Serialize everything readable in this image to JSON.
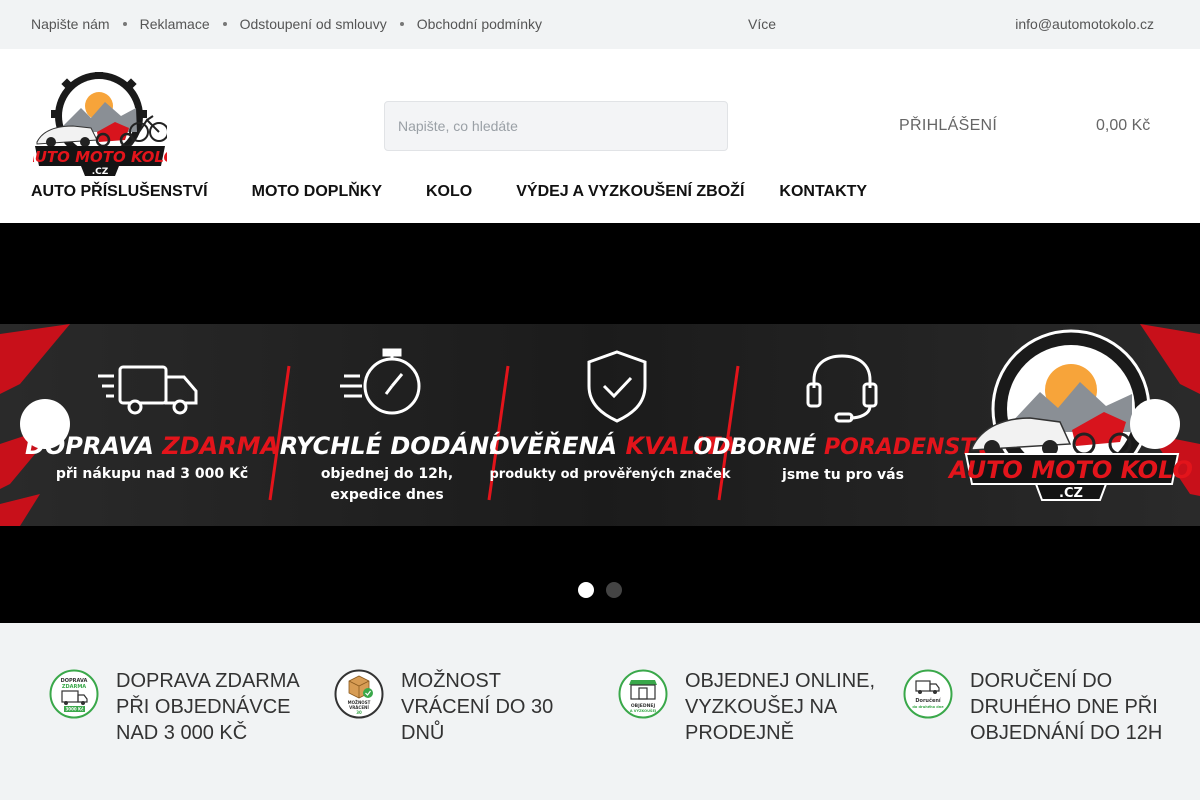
{
  "topbar": {
    "links": [
      "Napište nám",
      "Reklamace",
      "Odstoupení od smlouvy",
      "Obchodní podmínky"
    ],
    "more": "Více",
    "email": "info@automotokolo.cz"
  },
  "header": {
    "logo_text_1": "AUTO MOTO KOLO",
    "logo_text_2": ".CZ",
    "search_placeholder": "Napište, co hledáte",
    "login": "PŘIHLÁŠENÍ",
    "cart_total": "0,00 Kč"
  },
  "nav": [
    "AUTO PŘÍSLUŠENSTVÍ",
    "MOTO DOPLŇKY",
    "KOLO",
    "VÝDEJ A VYZKOUŠENÍ ZBOŽÍ",
    "KONTAKTY"
  ],
  "hero": {
    "items": [
      {
        "title_white": "DOPRAVA",
        "title_red": "ZDARMA",
        "sub": "při nákupu nad 3 000 Kč"
      },
      {
        "title_white": "RYCHLÉ DODÁNÍ",
        "title_red": "",
        "sub1": "objednej do 12h,",
        "sub2": "expedice dnes"
      },
      {
        "title_white": "OVĚŘENÁ",
        "title_red": "KVALITA",
        "sub": "produkty od prověřených značek"
      },
      {
        "title_white": "ODBORNÉ",
        "title_red": "PORADENSTVÍ",
        "sub": "jsme tu pro vás"
      }
    ],
    "slides_active": 0,
    "slide_count": 2
  },
  "benefits": [
    {
      "text": "DOPRAVA ZDARMA PŘI OBJEDNÁVCE NAD 3 000 KČ",
      "icon": "free-shipping-icon",
      "icon_label_1": "DOPRAVA",
      "icon_label_2": "ZDARMA",
      "icon_label_3": "3000 Kč"
    },
    {
      "text": "MOŽNOST VRÁCENÍ DO 30 DNŮ",
      "icon": "return-box-icon",
      "icon_label_1": "MOŽNOST",
      "icon_label_2": "VRÁCENÍ",
      "icon_label_3": "30"
    },
    {
      "text": "OBJEDNEJ ONLINE, VYZKOUŠEJ NA PRODEJNĚ",
      "icon": "store-icon",
      "icon_label_1": "OBJEDNEJ",
      "icon_label_2": "A VYZKOUŠEJ"
    },
    {
      "text": "DORUČENÍ DO DRUHÉHO DNE PŘI OBJEDNÁNÍ DO 12H",
      "icon": "delivery-truck-icon",
      "icon_label_1": "Doručení",
      "icon_label_2": "do druhého dne"
    }
  ],
  "colors": {
    "accent_red": "#e3141b",
    "brand_green": "#3aa84a",
    "logo_yellow": "#f5c800"
  }
}
